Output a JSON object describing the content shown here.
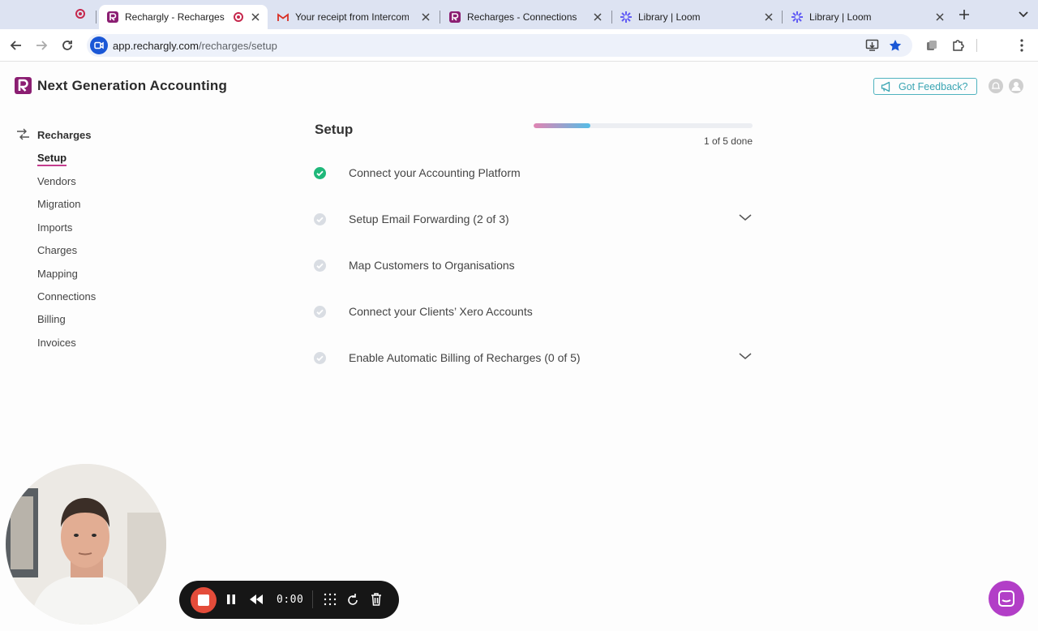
{
  "browser": {
    "tabs": [
      {
        "title": "",
        "favicon": "record-icon",
        "active": false
      },
      {
        "title": "Rechargly - Recharges",
        "favicon": "rechargly-logo",
        "active": true
      },
      {
        "title": "Your receipt from Intercom R",
        "favicon": "gmail-icon",
        "active": false
      },
      {
        "title": "Recharges - Connections",
        "favicon": "rechargly-logo",
        "active": false
      },
      {
        "title": "Library | Loom",
        "favicon": "loom-icon",
        "active": false
      },
      {
        "title": "Library | Loom",
        "favicon": "loom-icon",
        "active": false
      }
    ],
    "url_host": "app.rechargly.com",
    "url_path": "/recharges/setup"
  },
  "header": {
    "brand": "Next Generation Accounting",
    "feedback_label": "Got Feedback?"
  },
  "sidebar": {
    "section": "Recharges",
    "items": [
      {
        "label": "Setup",
        "active": true
      },
      {
        "label": "Vendors",
        "active": false
      },
      {
        "label": "Migration",
        "active": false
      },
      {
        "label": "Imports",
        "active": false
      },
      {
        "label": "Charges",
        "active": false
      },
      {
        "label": "Mapping",
        "active": false
      },
      {
        "label": "Connections",
        "active": false
      },
      {
        "label": "Billing",
        "active": false
      },
      {
        "label": "Invoices",
        "active": false
      }
    ]
  },
  "setup": {
    "title": "Setup",
    "progress_fraction": 0.26,
    "progress_text": "1 of 5 done",
    "steps": [
      {
        "label": "Connect your Accounting Platform",
        "done": true,
        "expandable": false
      },
      {
        "label": "Setup Email Forwarding (2 of 3)",
        "done": false,
        "expandable": true
      },
      {
        "label": "Map Customers to Organisations",
        "done": false,
        "expandable": false
      },
      {
        "label": "Connect your Clients’ Xero Accounts",
        "done": false,
        "expandable": false
      },
      {
        "label": "Enable Automatic Billing of Recharges (0 of 5)",
        "done": false,
        "expandable": true
      }
    ]
  },
  "recorder": {
    "timer": "0:00"
  },
  "colors": {
    "brand": "#8b1e72",
    "accent_teal": "#3aa5b3",
    "done_green": "#1fb87a",
    "stop_red": "#e44c3a",
    "chat_purple": "#b23ec7"
  }
}
